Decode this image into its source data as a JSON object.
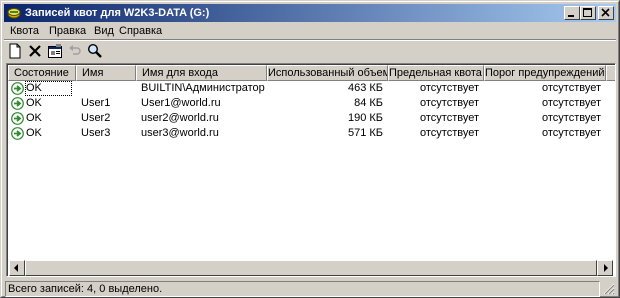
{
  "window": {
    "title": "Записей квот для W2K3-DATA (G:)",
    "title_icon": "quota-icon",
    "controls": {
      "minimize": "_",
      "maximize": "□",
      "close": "×"
    }
  },
  "menu": [
    {
      "label": "Квота",
      "key": "К"
    },
    {
      "label": "Правка",
      "key": "П"
    },
    {
      "label": "Вид",
      "key": "В"
    },
    {
      "label": "Справка",
      "key": "С"
    }
  ],
  "toolbar": [
    {
      "name": "new-entry",
      "icon": "new-document-icon"
    },
    {
      "name": "delete",
      "icon": "delete-x-icon"
    },
    {
      "name": "properties",
      "icon": "properties-icon"
    },
    {
      "name": "undo",
      "icon": "undo-icon",
      "disabled": true
    },
    {
      "name": "find",
      "icon": "magnifier-icon"
    }
  ],
  "columns": [
    "Состояние",
    "Имя",
    "Имя для входа",
    "Использованный объем",
    "Предельная квота",
    "Порог предупреждений"
  ],
  "rows": [
    {
      "status": "OK",
      "name": "",
      "login": "BUILTIN\\Администраторы",
      "used": "463 КБ",
      "limit": "отсутствует",
      "warning": "отсутствует",
      "status_icon": "ok-arrow-icon"
    },
    {
      "status": "OK",
      "name": "User1",
      "login": "User1@world.ru",
      "used": "84 КБ",
      "limit": "отсутствует",
      "warning": "отсутствует",
      "status_icon": "ok-arrow-icon"
    },
    {
      "status": "OK",
      "name": "User2",
      "login": "user2@world.ru",
      "used": "190 КБ",
      "limit": "отсутствует",
      "warning": "отсутствует",
      "status_icon": "ok-arrow-icon"
    },
    {
      "status": "OK",
      "name": "User3",
      "login": "user3@world.ru",
      "used": "571 КБ",
      "limit": "отсутствует",
      "warning": "отсутствует",
      "status_icon": "ok-arrow-icon"
    }
  ],
  "status_bar": {
    "text": "Всего записей: 4, 0 выделено."
  },
  "colors": {
    "title_start": "#0a246a",
    "title_end": "#a6caf0",
    "face": "#d4d0c8",
    "status_ok_icon": "#2e8b2e"
  }
}
